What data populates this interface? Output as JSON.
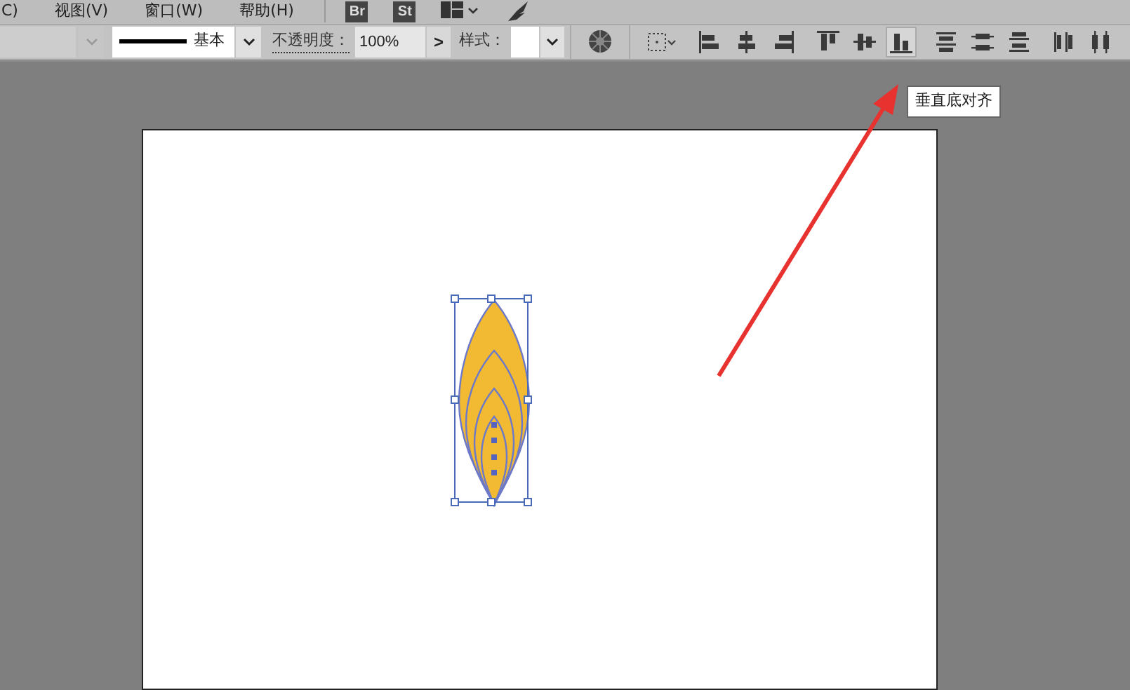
{
  "menu": [
    {
      "label": "C)"
    },
    {
      "label": "视图(V)"
    },
    {
      "label": "窗口(W)"
    },
    {
      "label": "帮助(H)"
    }
  ],
  "app_badges": [
    {
      "label": "Br"
    },
    {
      "label": "St"
    }
  ],
  "control_bar": {
    "stroke_label": "基本",
    "opacity_label": "不透明度：",
    "opacity_value": "100%",
    "opacity_arrow": ">",
    "style_label": "样式："
  },
  "align_buttons": [
    {
      "kind": "left",
      "selected": false
    },
    {
      "kind": "hcenter",
      "selected": false
    },
    {
      "kind": "right",
      "selected": false
    },
    {
      "kind": "top",
      "selected": false
    },
    {
      "kind": "vcenter",
      "selected": false
    },
    {
      "kind": "bottom",
      "selected": true
    },
    {
      "kind": "dist-top",
      "selected": false
    },
    {
      "kind": "dist-vcenter",
      "selected": false
    },
    {
      "kind": "dist-bottom",
      "selected": false
    },
    {
      "kind": "dist-left",
      "selected": false
    },
    {
      "kind": "dist-hcenter",
      "selected": false
    }
  ],
  "tooltip": "垂直底对齐"
}
